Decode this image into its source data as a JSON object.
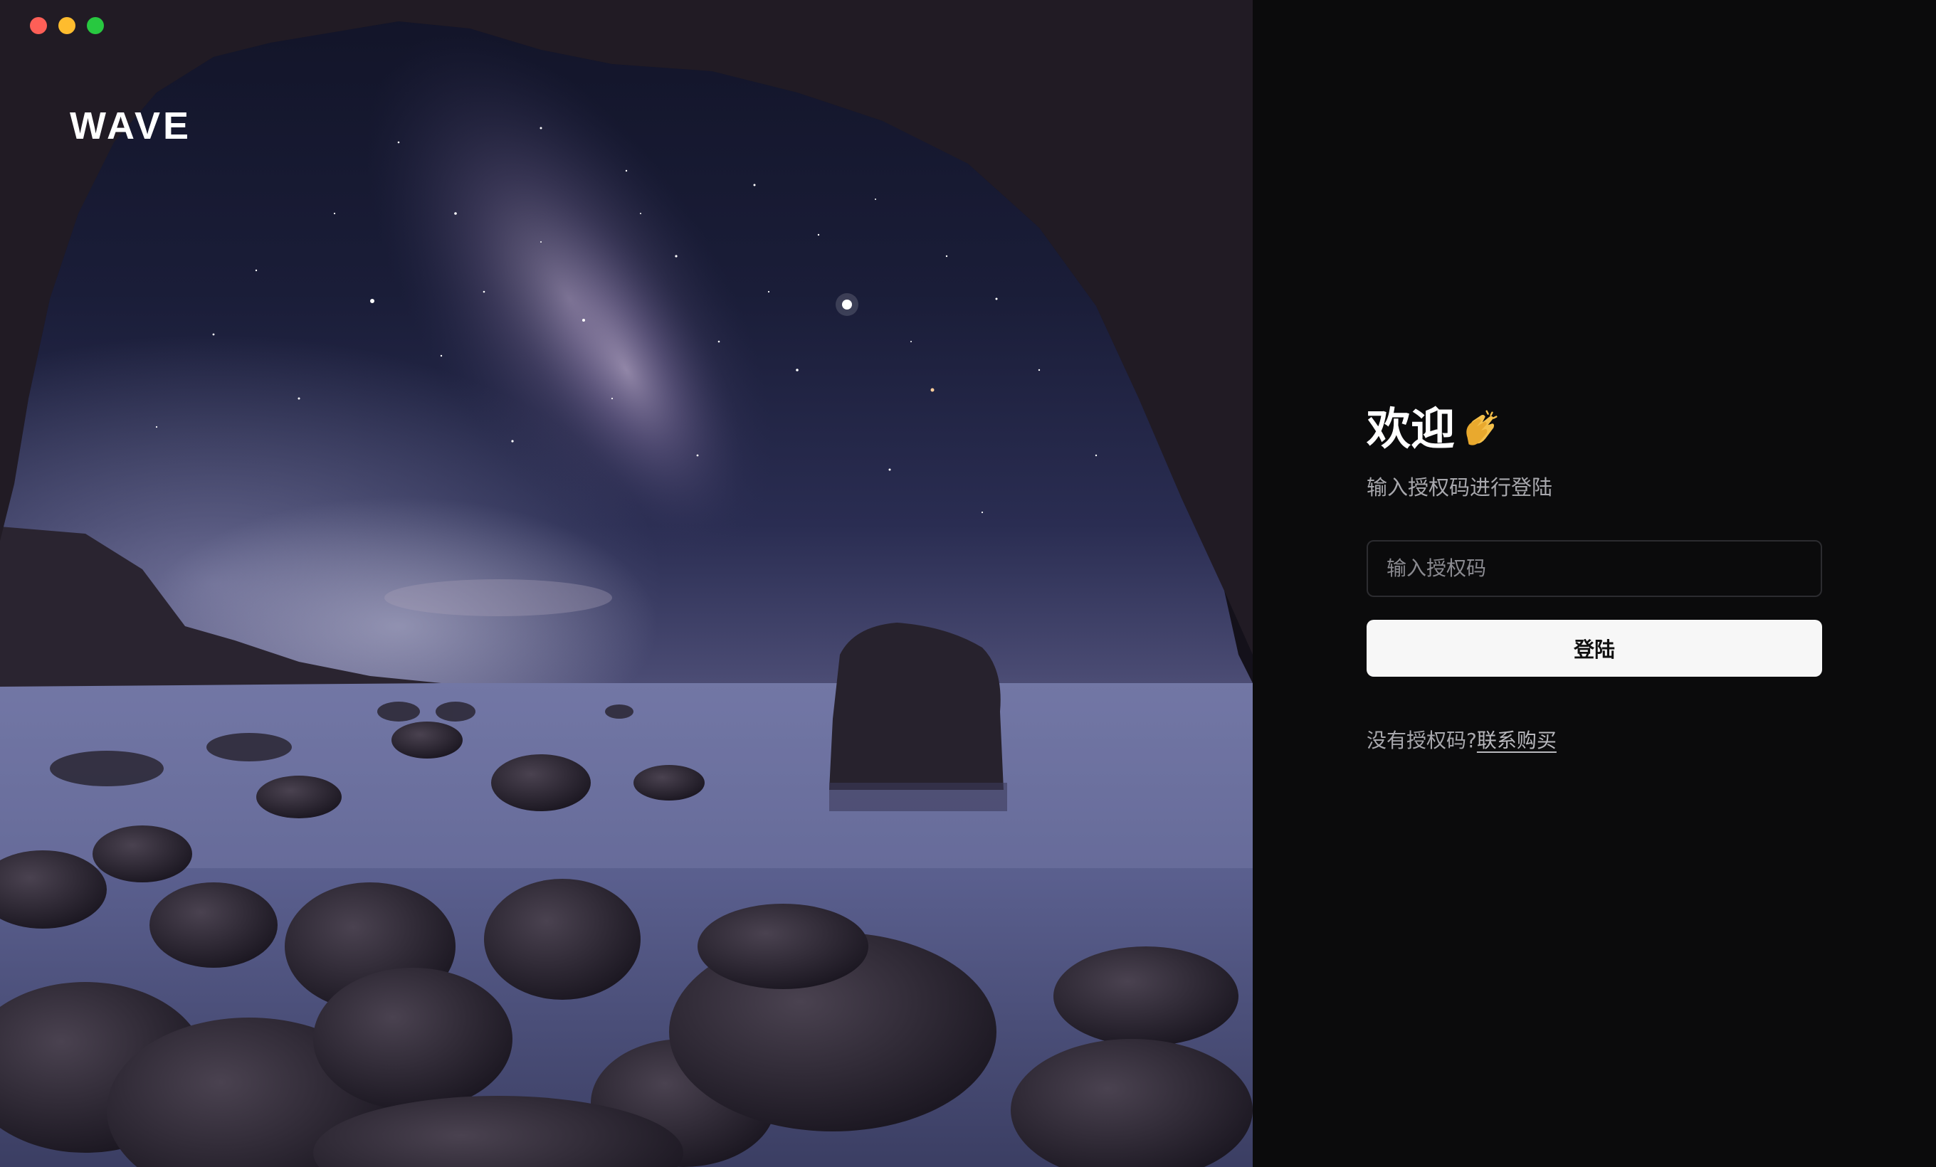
{
  "window": {
    "controls": [
      "close",
      "minimize",
      "maximize"
    ]
  },
  "brand": {
    "logo_text": "WAVE"
  },
  "login": {
    "title": "欢迎",
    "title_icon": "clapping-hands-icon",
    "subtitle": "输入授权码进行登陆",
    "auth_code": {
      "value": "",
      "placeholder": "输入授权码"
    },
    "submit_label": "登陆",
    "no_code_text": "没有授权码?",
    "purchase_link": "联系购买"
  },
  "colors": {
    "panel_bg": "#0b0b0c",
    "button_bg": "#f7f7f7",
    "text_primary": "#ffffff",
    "text_secondary": "#a8a8ad"
  }
}
